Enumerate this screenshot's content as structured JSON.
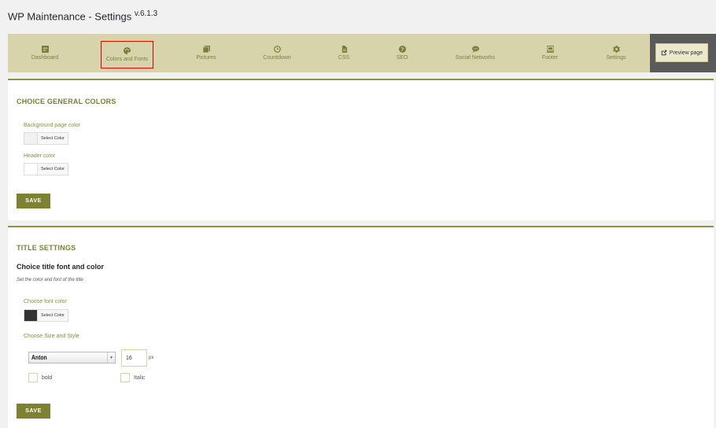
{
  "header": {
    "title": "WP Maintenance - Settings",
    "version": "v.6.1.3"
  },
  "nav": {
    "items": [
      {
        "label": "Dashboard",
        "icon": "dashboard-icon"
      },
      {
        "label": "Colors and Fonts",
        "icon": "palette-icon",
        "active": true
      },
      {
        "label": "Pictures",
        "icon": "pictures-icon"
      },
      {
        "label": "Countdown",
        "icon": "clock-icon"
      },
      {
        "label": "CSS",
        "icon": "file-icon"
      },
      {
        "label": "SEO",
        "icon": "globe-icon"
      },
      {
        "label": "Social Networks",
        "icon": "chat-icon"
      },
      {
        "label": "Footer",
        "icon": "footer-icon"
      },
      {
        "label": "Settings",
        "icon": "gear-icon"
      }
    ],
    "preview_label": "Preview page"
  },
  "general_colors": {
    "title": "CHOICE GENERAL COLORS",
    "background_label": "Background page color",
    "background_value": "#f1f1f1",
    "header_label": "Header color",
    "header_value": "#ffffff",
    "select_label": "Select Color",
    "save_label": "SAVE"
  },
  "title_settings": {
    "title": "TITLE SETTINGS",
    "subheading": "Choice title font and color",
    "description": "Set the color and font of the title",
    "font_color_label": "Choose font color",
    "font_color_value": "#333333",
    "select_label": "Select Color",
    "size_style_label": "Choose Size and Style",
    "font_family_value": "Anton",
    "font_size_value": "16",
    "unit": "px",
    "bold_label": "bold",
    "italic_label": "Italic",
    "save_label": "SAVE"
  },
  "colors": {
    "accent": "#7d8233",
    "nav_bg": "#d7d3ab",
    "active_outline": "#e00000"
  }
}
